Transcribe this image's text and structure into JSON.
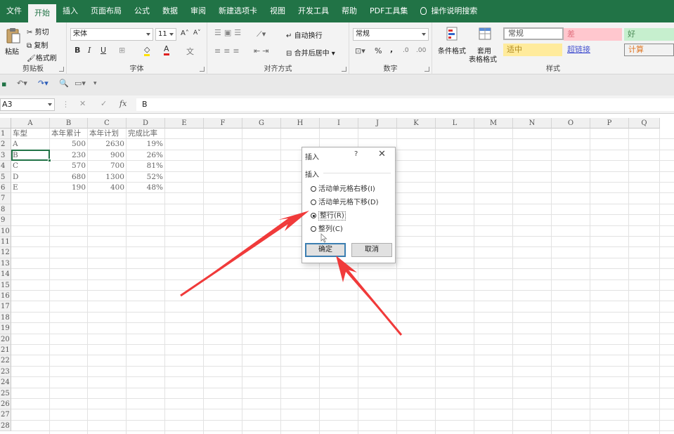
{
  "tabs": [
    {
      "label": "文件",
      "active": false
    },
    {
      "label": "开始",
      "active": true
    },
    {
      "label": "插入",
      "active": false
    },
    {
      "label": "页面布局",
      "active": false
    },
    {
      "label": "公式",
      "active": false
    },
    {
      "label": "数据",
      "active": false
    },
    {
      "label": "审阅",
      "active": false
    },
    {
      "label": "新建选项卡",
      "active": false
    },
    {
      "label": "视图",
      "active": false
    },
    {
      "label": "开发工具",
      "active": false
    },
    {
      "label": "帮助",
      "active": false
    },
    {
      "label": "PDF工具集",
      "active": false
    }
  ],
  "search_tab": "操作说明搜索",
  "clipboard": {
    "paste": "粘贴",
    "cut": "剪切",
    "copy": "复制",
    "format_painter": "格式刷",
    "label": "剪贴板"
  },
  "font": {
    "name": "宋体",
    "size": "11",
    "bold": "B",
    "italic": "I",
    "underline": "U",
    "label": "字体"
  },
  "alignment": {
    "wrap": "自动换行",
    "merge": "合并后居中",
    "label": "对齐方式"
  },
  "number": {
    "format": "常规",
    "percent": "%",
    "comma": ",",
    "label": "数字"
  },
  "styles": {
    "conditional": "条件格式",
    "table_format_1": "套用",
    "table_format_2": "表格格式",
    "label": "样式",
    "cells": [
      {
        "label": "常规",
        "bg": "#ffffff",
        "color": "#555555"
      },
      {
        "label": "差",
        "bg": "#ffc7ce",
        "color": "#e0707e"
      },
      {
        "label": "好",
        "bg": "#c6efce",
        "color": "#4a8a55"
      },
      {
        "label": "适中",
        "bg": "#ffeb9c",
        "color": "#b08a20"
      },
      {
        "label": "超链接",
        "bg": "#f3f3f3",
        "color": "#4a56d0"
      },
      {
        "label": "计算",
        "bg": "#f2f2f2",
        "color": "#e07a2a"
      }
    ]
  },
  "formula_bar": {
    "name_box": "A3",
    "fx": "fx",
    "value": "B"
  },
  "columns": [
    "A",
    "B",
    "C",
    "D",
    "E",
    "F",
    "G",
    "H",
    "I",
    "J",
    "K",
    "L",
    "M",
    "N",
    "O",
    "P",
    "Q"
  ],
  "rows": [
    "1",
    "2",
    "3",
    "4",
    "5",
    "6",
    "7",
    "8",
    "9",
    "10",
    "11",
    "12",
    "13",
    "14",
    "15",
    "16",
    "17",
    "18",
    "19",
    "20",
    "21",
    "22",
    "23",
    "24",
    "25",
    "26",
    "27",
    "28"
  ],
  "table": {
    "headers": [
      "车型",
      "本年累计",
      "本年计划",
      "完成比率"
    ],
    "rows": [
      [
        "A",
        "500",
        "2630",
        "19%"
      ],
      [
        "B",
        "230",
        "900",
        "26%"
      ],
      [
        "C",
        "570",
        "700",
        "81%"
      ],
      [
        "D",
        "680",
        "1300",
        "52%"
      ],
      [
        "E",
        "190",
        "400",
        "48%"
      ]
    ]
  },
  "dialog": {
    "title": "插入",
    "help": "?",
    "close": "✕",
    "group": "插入",
    "options": [
      {
        "label": "活动单元格右移(I)",
        "checked": false
      },
      {
        "label": "活动单元格下移(D)",
        "checked": false
      },
      {
        "label": "整行(R)",
        "checked": true
      },
      {
        "label": "整列(C)",
        "checked": false
      }
    ],
    "ok": "确定",
    "cancel": "取消"
  },
  "colors": {
    "accent": "#217346",
    "arrow": "#f03a3a"
  }
}
